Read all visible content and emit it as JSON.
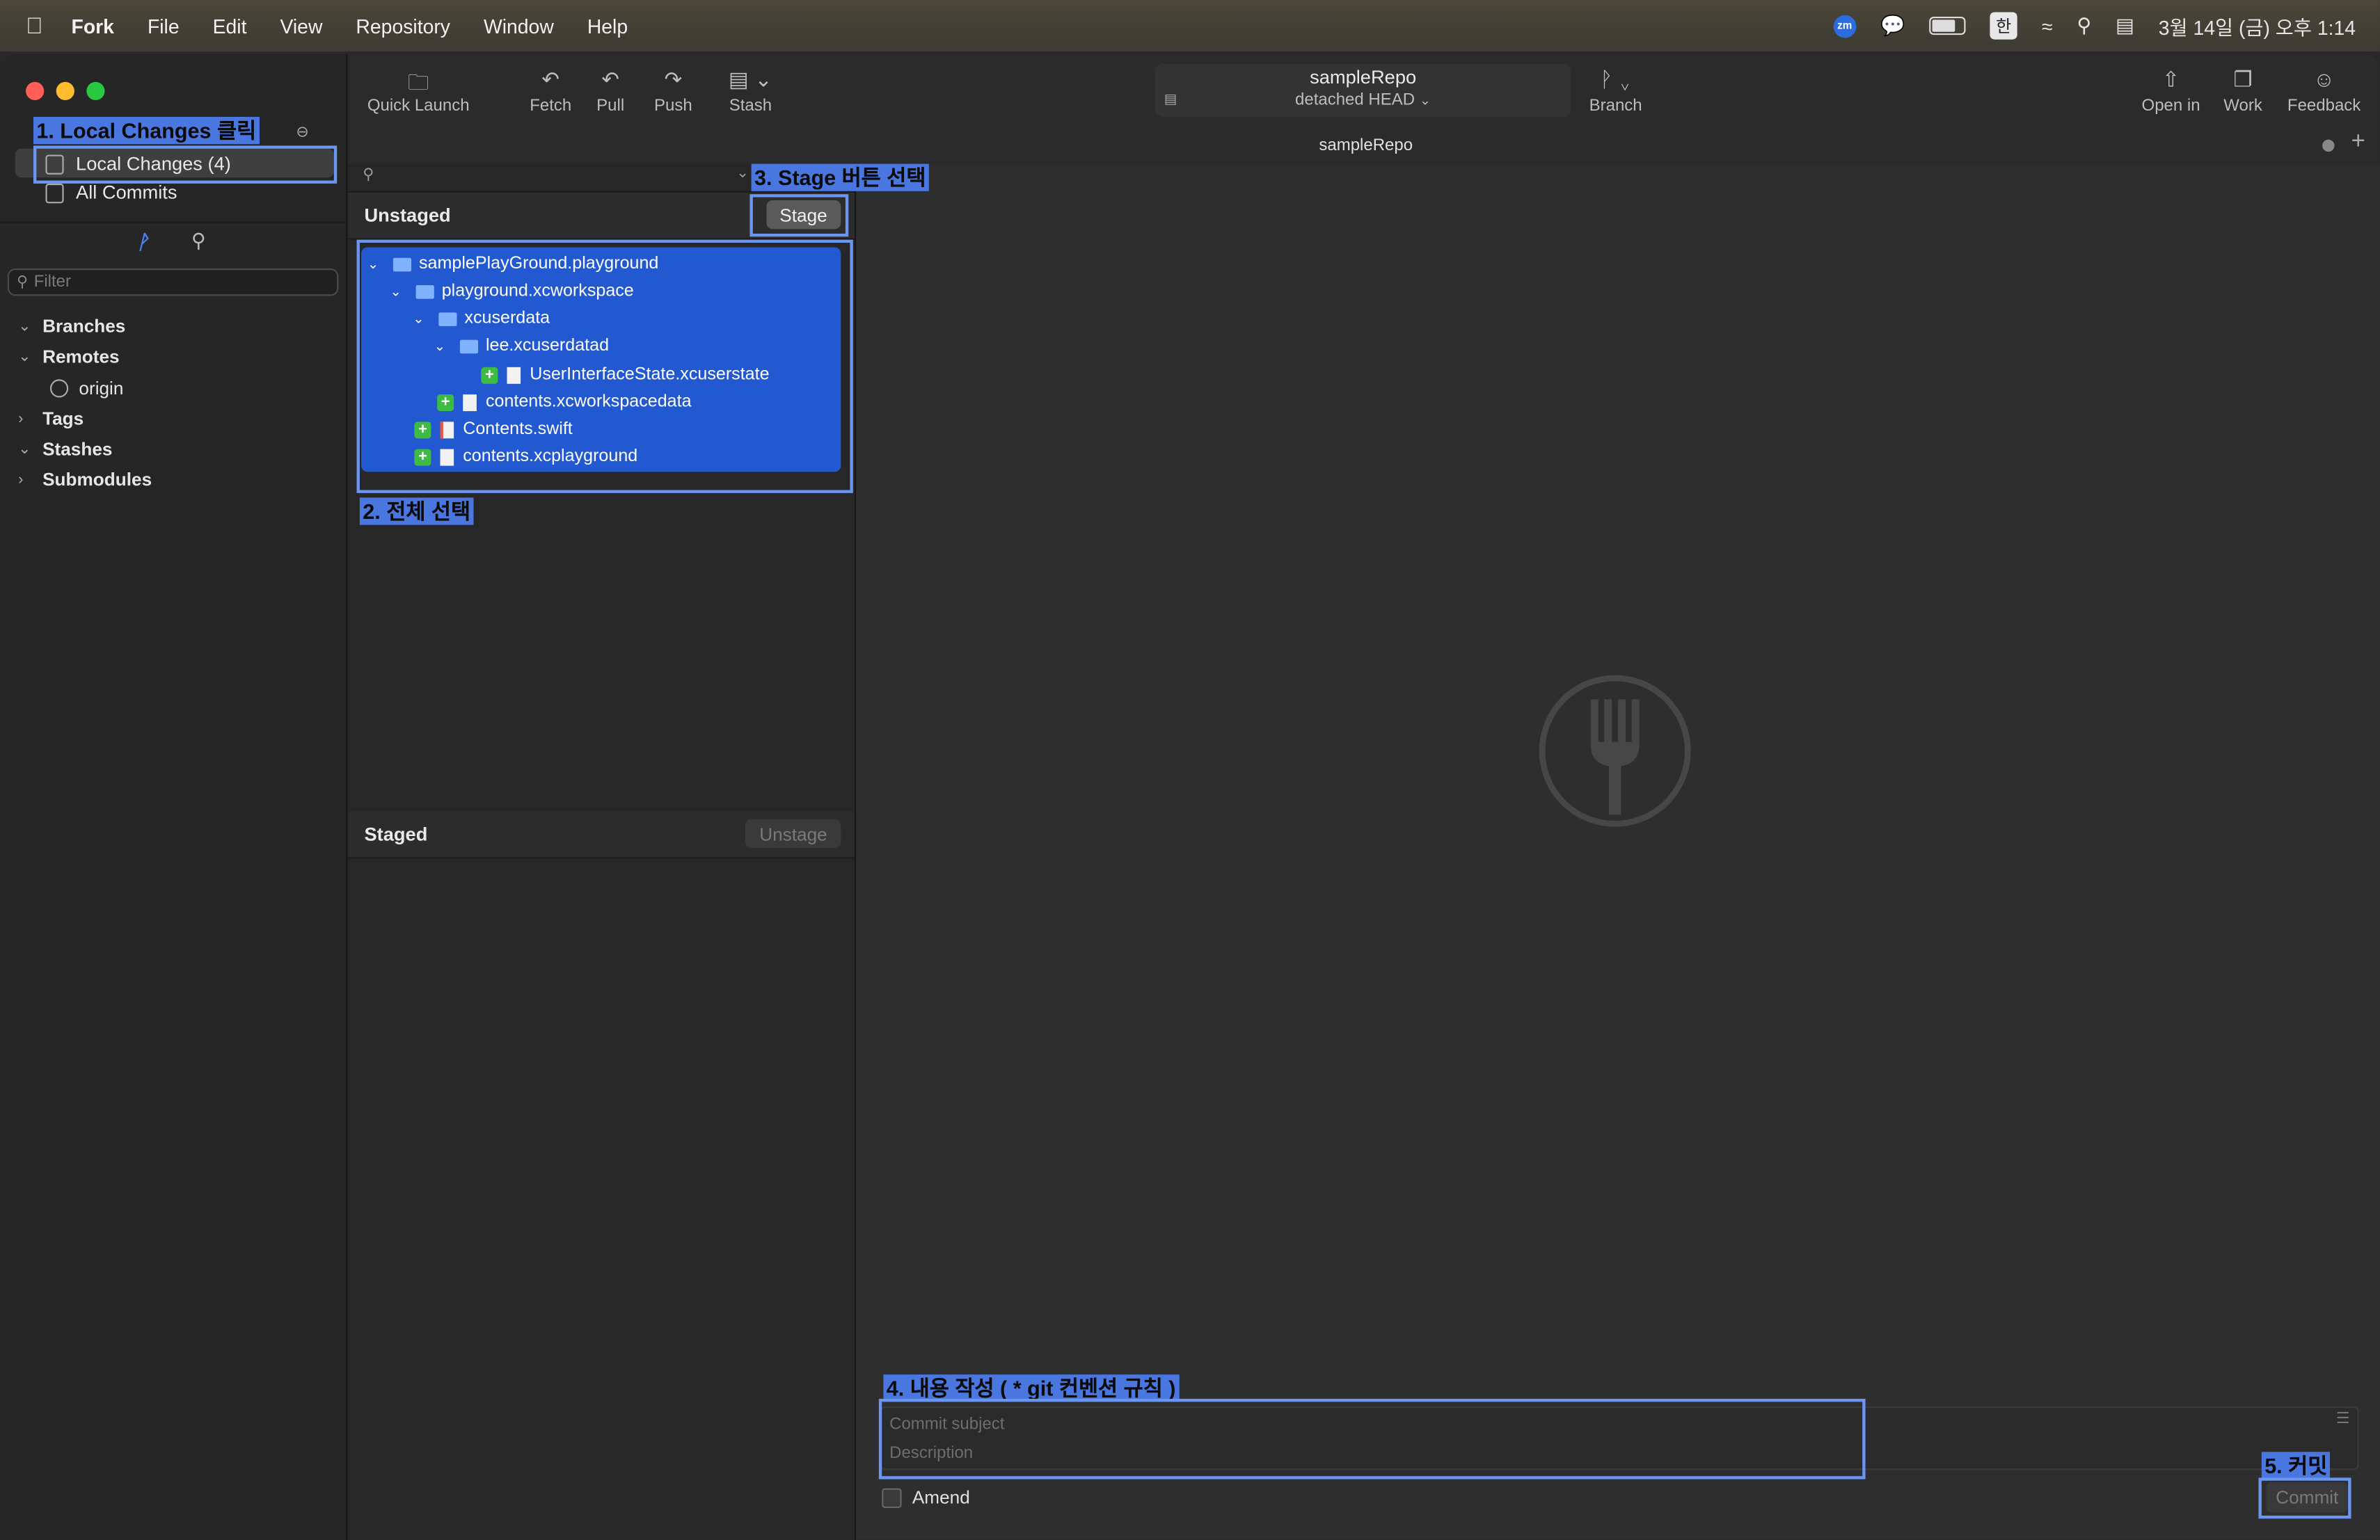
{
  "menubar": {
    "app": "Fork",
    "menus": [
      "File",
      "Edit",
      "View",
      "Repository",
      "Window",
      "Help"
    ],
    "ime": "한",
    "zoom_badge": "zm",
    "datetime": "3월 14일 (금) 오후 1:14"
  },
  "sidebar": {
    "local_changes": "Local Changes (4)",
    "all_commits": "All Commits",
    "filter_placeholder": "Filter",
    "sections": {
      "branches": "Branches",
      "remotes": "Remotes",
      "origin": "origin",
      "tags": "Tags",
      "stashes": "Stashes",
      "submodules": "Submodules"
    }
  },
  "toolbar": {
    "quick_launch": "Quick Launch",
    "fetch": "Fetch",
    "pull": "Pull",
    "push": "Push",
    "stash": "Stash",
    "repo_name": "sampleRepo",
    "repo_state": "detached HEAD",
    "branch": "Branch",
    "open_in": "Open in",
    "work": "Work",
    "feedback": "Feedback"
  },
  "tab": {
    "title": "sampleRepo"
  },
  "unstaged": {
    "title": "Unstaged",
    "stage_button": "Stage",
    "files": [
      "samplePlayGround.playground",
      "playground.xcworkspace",
      "xcuserdata",
      "lee.xcuserdatad",
      "UserInterfaceState.xcuserstate",
      "contents.xcworkspacedata",
      "Contents.swift",
      "contents.xcplayground"
    ]
  },
  "staged": {
    "title": "Staged",
    "unstage_button": "Unstage"
  },
  "commit": {
    "subject_placeholder": "Commit subject",
    "description_placeholder": "Description",
    "amend": "Amend",
    "button": "Commit"
  },
  "annotations": {
    "a1": "1. Local Changes 클릭",
    "a2": "2. 전체 선택",
    "a3": "3. Stage 버튼 선택",
    "a4": "4. 내용 작성 ( * git 컨벤션 규칙 )",
    "a5": "5. 커밋"
  },
  "colors": {
    "selection": "#2258d0",
    "annotation": "#4a76e0",
    "added": "#3dbb45"
  }
}
